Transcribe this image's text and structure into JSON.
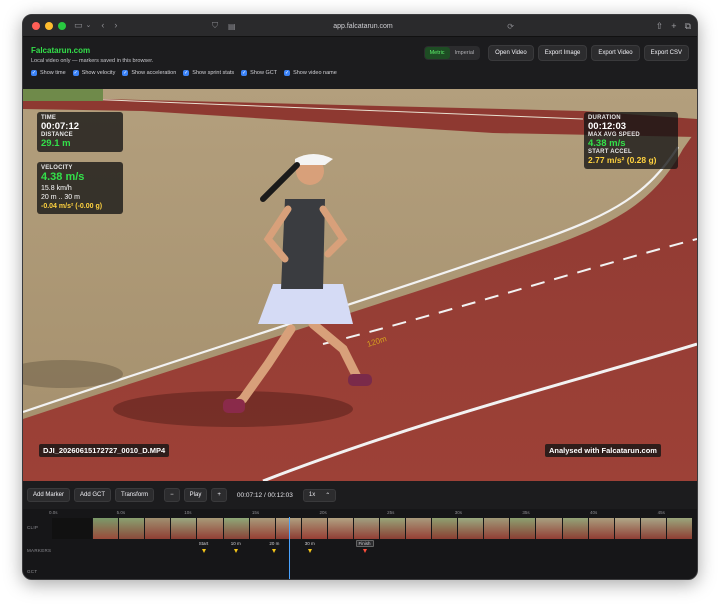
{
  "browser": {
    "url": "app.falcatarun.com"
  },
  "icons": {
    "sidebar": "sidebar-icon",
    "back": "chevron-left-icon",
    "forward": "chevron-right-icon",
    "shield": "shield-icon",
    "reader": "reader-icon",
    "translate": "translate-icon",
    "reload": "reload-icon",
    "share": "share-icon",
    "new_tab": "plus-icon",
    "tabs": "tabs-overview-icon",
    "check": "checkmark-icon"
  },
  "colors": {
    "brand": "#33e04a",
    "accent_blue": "#3b82f6",
    "highlight_yellow": "#ffd23f",
    "marker_yellow": "#f5c518",
    "marker_red": "#ff4d3a",
    "playhead": "#4aa3ff",
    "track": "#9b3f36"
  },
  "app": {
    "title": "Falcatarun.com",
    "subtitle": "Local video only — markers saved in this browser.",
    "options": [
      {
        "label": "Show time",
        "checked": true
      },
      {
        "label": "Show velocity",
        "checked": true
      },
      {
        "label": "Show acceleration",
        "checked": true
      },
      {
        "label": "Show sprint stats",
        "checked": true
      },
      {
        "label": "Show GCT",
        "checked": true
      },
      {
        "label": "Show video name",
        "checked": true
      }
    ],
    "units": {
      "metric": "Metric",
      "imperial": "Imperial",
      "selected": "Metric"
    },
    "buttons": {
      "open_video": "Open Video",
      "export_image": "Export Image",
      "export_video": "Export Video",
      "export_csv": "Export CSV"
    }
  },
  "overlay": {
    "time_label": "TIME",
    "time_value": "00:07:12",
    "distance_label": "DISTANCE",
    "distance_value": "29.1 m",
    "velocity_label": "VELOCITY",
    "velocity_value": "4.38 m/s",
    "velocity_kmh": "15.8 km/h",
    "velocity_range": "20 m .. 30 m",
    "acceleration": "-0.04 m/s² (-0.00 g)",
    "duration_label": "DURATION",
    "duration_value": "00:12:03",
    "max_speed_label": "MAX AVG SPEED",
    "max_speed_value": "4.38 m/s",
    "start_accel_label": "START ACCEL",
    "start_accel_value": "2.77 m/s² (0.28 g)",
    "video_name": "DJI_20260615172727_0010_D.MP4",
    "watermark": "Analysed with Falcatarun.com",
    "track_text": "120m"
  },
  "controls": {
    "add_marker": "Add Marker",
    "add_gct": "Add GCT",
    "transform": "Transform",
    "minus": "−",
    "play": "Play",
    "plus": "+",
    "time_display": "00:07:12 / 00:12:03",
    "speed": "1x",
    "speed_caret": "⌃"
  },
  "timeline": {
    "rows": {
      "clip": "CLIP",
      "markers": "MARKERS",
      "gct": "GCT"
    },
    "ticks": [
      "0.0s",
      "5.0s",
      "10s",
      "15s",
      "20s",
      "25s",
      "30s",
      "35s",
      "40s",
      "45s"
    ],
    "markers": [
      {
        "label": "Start",
        "pos": 0.24,
        "color": "yellow"
      },
      {
        "label": "10 m",
        "pos": 0.29,
        "color": "yellow"
      },
      {
        "label": "20 m",
        "pos": 0.35,
        "color": "yellow"
      },
      {
        "label": "30 m",
        "pos": 0.405,
        "color": "yellow"
      },
      {
        "label": "Finish",
        "pos": 0.49,
        "color": "red"
      }
    ],
    "playhead_position": 0.41
  }
}
